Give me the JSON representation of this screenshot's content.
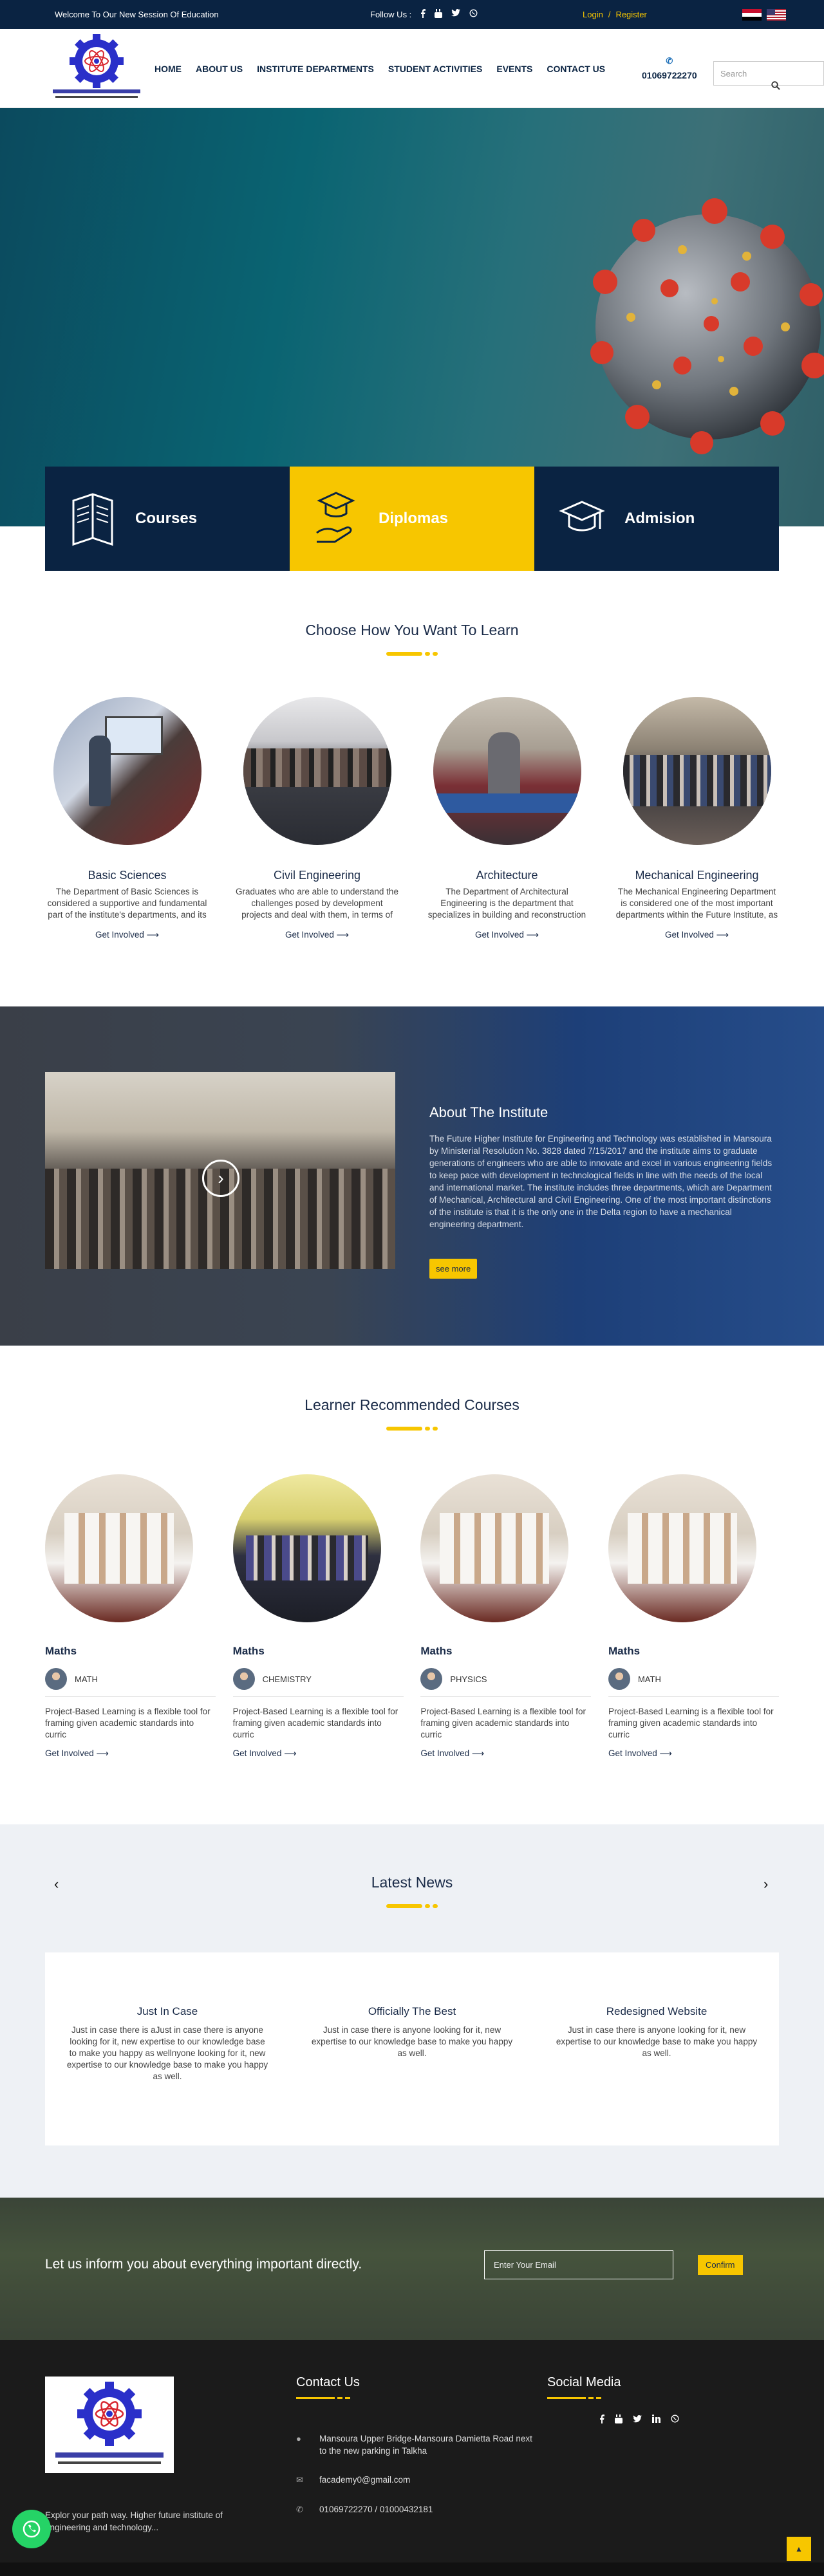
{
  "topbar": {
    "welcome": "Welcome To Our New Session Of Education",
    "follow_label": "Follow Us :",
    "social_icons": [
      "facebook-icon",
      "youtube-icon",
      "twitter-icon",
      "whatsapp-icon"
    ],
    "login": "Login",
    "separator": "/",
    "register": "Register",
    "languages": [
      "Arabic",
      "English"
    ]
  },
  "header": {
    "nav": [
      "HOME",
      "ABOUT US",
      "INSTITUTE DEPARTMENTS",
      "STUDENT ACTIVITIES",
      "EVENTS",
      "CONTACT US"
    ],
    "phone": "01069722270",
    "search_placeholder": "Search"
  },
  "features": [
    {
      "label": "Courses",
      "icon": "book-icon",
      "style": "dark"
    },
    {
      "label": "Diplomas",
      "icon": "certificate-hand-icon",
      "style": "yellow"
    },
    {
      "label": "Admision",
      "icon": "graduation-cap-icon",
      "style": "dark"
    }
  ],
  "departments": {
    "title": "Choose How You Want To Learn",
    "items": [
      {
        "name": "Basic Sciences",
        "desc": "The Department of Basic Sciences is considered a supportive and fundamental part of the institute's departments, and its main importance lies in pro",
        "more": "Get Involved ⟶"
      },
      {
        "name": "Civil Engineering",
        "desc": "Graduates who are able to understand the challenges posed by development projects and deal with them, in terms of design and implementation of all dev",
        "more": "Get Involved ⟶"
      },
      {
        "name": "Architecture",
        "desc": "The Department of Architectural Engineering is the department that specializes in building and reconstruction engineering, starting from designing bui",
        "more": "Get Involved ⟶"
      },
      {
        "name": "Mechanical Engineering",
        "desc": "The Mechanical Engineering Department is considered one of the most important departments within the Future Institute, as it is unique in being the on",
        "more": "Get Involved ⟶"
      }
    ]
  },
  "about": {
    "title": "About The Institute",
    "text": "The Future Higher Institute for Engineering and Technology was established in Mansoura by Ministerial Resolution No. 3828 dated 7/15/2017 and the institute aims to graduate generations of engineers who are able to innovate and excel in various engineering fields to keep pace with development in technological fields in line with the needs of the local and international market. The institute includes three departments, which are Department of Mechanical, Architectural and Civil Engineering. One of the most important distinctions of the institute is that it is the only one in the Delta region to have a mechanical engineering department.",
    "button": "see more"
  },
  "courses": {
    "title": "Learner Recommended Courses",
    "items": [
      {
        "title": "Maths",
        "teacher": "MATH",
        "desc": "Project-Based Learning is a flexible tool for framing given academic standards into curric",
        "more": "Get Involved ⟶"
      },
      {
        "title": "Maths",
        "teacher": "CHEMISTRY",
        "desc": "Project-Based Learning is a flexible tool for framing given academic standards into curric",
        "more": "Get Involved ⟶"
      },
      {
        "title": "Maths",
        "teacher": "PHYSICS",
        "desc": "Project-Based Learning is a flexible tool for framing given academic standards into curric",
        "more": "Get Involved ⟶"
      },
      {
        "title": "Maths",
        "teacher": "MATH",
        "desc": "Project-Based Learning is a flexible tool for framing given academic standards into curric",
        "more": "Get Involved ⟶"
      }
    ]
  },
  "news": {
    "title": "Latest News",
    "items": [
      {
        "title": "Just In Case",
        "desc": "Just in case there is aJust in case there is anyone looking for it, new expertise to our knowledge base to make you happy as wellnyone looking for it, new expertise to our knowledge base to make you happy as well."
      },
      {
        "title": "Officially The Best",
        "desc": "Just in case there is anyone looking for it, new expertise to our knowledge base to make you happy as well."
      },
      {
        "title": "Redesigned Website",
        "desc": "Just in case there is anyone looking for it, new expertise to our knowledge base to make you happy as well."
      }
    ]
  },
  "subscribe": {
    "message": "Let us inform you about everything important directly.",
    "placeholder": "Enter Your Email",
    "button": "Confirm"
  },
  "footer": {
    "tagline": "Explor your path way. Higher future institute of engineering and technology...",
    "contact_title": "Contact Us",
    "address": "Mansoura Upper Bridge-Mansoura Damietta Road next to the new parking in Talkha",
    "email": "facademy0@gmail.com",
    "phones": "01069722270 / 01000432181",
    "social_title": "Social Media"
  },
  "colors": {
    "navy": "#0a2342",
    "yellow": "#f7c600"
  }
}
